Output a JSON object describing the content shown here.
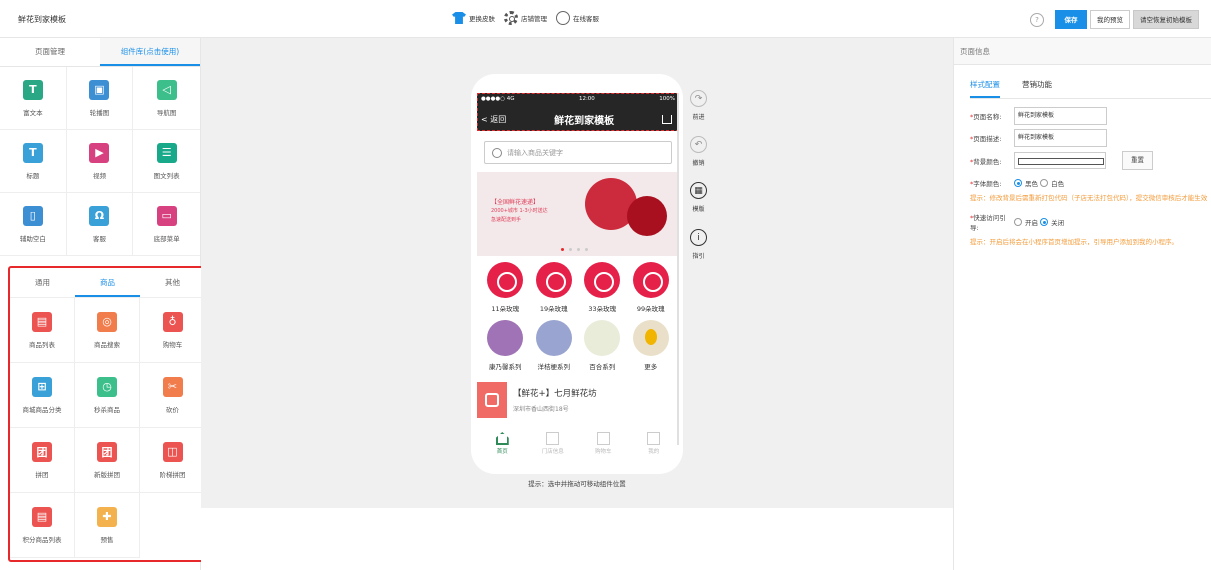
{
  "topbar": {
    "title": "鲜花到家模板",
    "skin": "更换皮肤",
    "store": "店铺管理",
    "service": "在线客服",
    "help": "?",
    "save": "保存",
    "preview": "我的预览",
    "reset": "请空恢复初始模板"
  },
  "left": {
    "tab_page": "页面管理",
    "tab_components": "组件库(点击使用)",
    "components": [
      {
        "label": "富文本",
        "icon": "rich-text-icon",
        "g": "T"
      },
      {
        "label": "轮播图",
        "icon": "carousel-icon",
        "g": "▣"
      },
      {
        "label": "导航图",
        "icon": "nav-icon",
        "g": "◁"
      },
      {
        "label": "标题",
        "icon": "title-icon",
        "g": "T"
      },
      {
        "label": "视频",
        "icon": "video-icon",
        "g": "▶"
      },
      {
        "label": "图文列表",
        "icon": "list-icon",
        "g": "☰"
      },
      {
        "label": "辅助空白",
        "icon": "blank-icon",
        "g": "▯"
      },
      {
        "label": "客服",
        "icon": "headset-icon",
        "g": "Ω"
      },
      {
        "label": "底部菜单",
        "icon": "menu-icon",
        "g": "▭"
      }
    ],
    "sub_tabs": [
      "通用",
      "商品",
      "其他"
    ],
    "goods": [
      {
        "label": "商品列表",
        "icon": "goods-list-icon",
        "g": "▤"
      },
      {
        "label": "商品搜索",
        "icon": "goods-search-icon",
        "g": "◎"
      },
      {
        "label": "购物车",
        "icon": "cart-icon",
        "g": "♁"
      },
      {
        "label": "商城商品分类",
        "icon": "category-icon",
        "g": "⊞"
      },
      {
        "label": "秒杀商品",
        "icon": "clock-icon",
        "g": "◷"
      },
      {
        "label": "砍价",
        "icon": "bargain-icon",
        "g": "✂"
      },
      {
        "label": "拼团",
        "icon": "group-icon",
        "g": "团"
      },
      {
        "label": "新版拼团",
        "icon": "new-group-icon",
        "g": "团"
      },
      {
        "label": "阶梯拼团",
        "icon": "step-group-icon",
        "g": "◫"
      },
      {
        "label": "积分商品列表",
        "icon": "points-icon",
        "g": "▤"
      },
      {
        "label": "预售",
        "icon": "presale-icon",
        "g": "✚"
      }
    ]
  },
  "phone": {
    "status_left": "●●●●○ 4G",
    "status_time": "12:00",
    "status_right": "100%",
    "back": "返回",
    "title": "鲜花到家模板",
    "search_placeholder": "请输入商品关键字",
    "banner": {
      "line1": "【全国鲜花速递】",
      "line2": "2000+城市 1-3小时送达",
      "line3": "急速配送到手"
    },
    "categories": [
      {
        "label": "11朵玫瑰",
        "cls": "rr"
      },
      {
        "label": "19朵玫瑰",
        "cls": "rr"
      },
      {
        "label": "33朵玫瑰",
        "cls": "rr"
      },
      {
        "label": "99朵玫瑰",
        "cls": "rr"
      },
      {
        "label": "康乃馨系列",
        "cls": "pp"
      },
      {
        "label": "洋桔梗系列",
        "cls": "bl"
      },
      {
        "label": "百合系列",
        "cls": "wh"
      },
      {
        "label": "更多",
        "cls": "zx"
      }
    ],
    "shop_name": "【鲜花+】七月鲜花坊",
    "shop_addr": "深圳市香山西街18号",
    "tabs": [
      {
        "label": "首页",
        "on": true
      },
      {
        "label": "门店信息",
        "on": false
      },
      {
        "label": "购物车",
        "on": false
      },
      {
        "label": "我的",
        "on": false
      }
    ],
    "hint": "提示：选中并拖动可移动组件位置"
  },
  "side": {
    "forward": "前进",
    "undo": "撤销",
    "template": "模版",
    "guide": "指引"
  },
  "right": {
    "header": "页面信息",
    "tab_style": "样式配置",
    "tab_marketing": "营销功能",
    "name_label": "页面名称:",
    "name_value": "鲜花到家模板",
    "desc_label": "页面描述:",
    "desc_value": "鲜花到家模板",
    "bg_label": "背景颜色:",
    "bg_reset": "重置",
    "font_label": "字体颜色:",
    "font_black": "黑色",
    "font_white": "白色",
    "tip1": "提示：修改背景后需重新打包代码（子店无法打包代码），提交微信审核后才能生效",
    "quick_label": "快速访问引导:",
    "quick_on": "开启",
    "quick_off": "关闭",
    "tip2": "提示：开启后将会在小程序首页增加提示，引导用户添加到我的小程序。"
  }
}
